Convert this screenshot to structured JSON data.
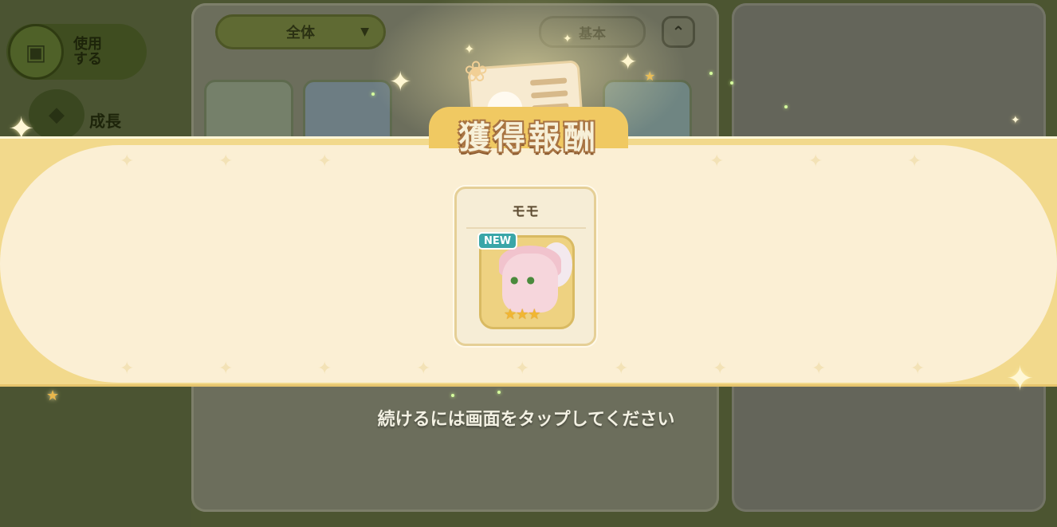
{
  "background": {
    "filter_dropdown": {
      "label": "全体",
      "caret": "▼"
    },
    "sort_button": {
      "label": "基本"
    },
    "collapse_button": {
      "label": "⌃"
    },
    "side_menu": {
      "use_label": "使用\nする",
      "grow_label": "成長"
    }
  },
  "reward_popup": {
    "title": "獲得報酬",
    "item": {
      "name": "モモ",
      "badge": "NEW",
      "stars": "★★★",
      "rarity": 3
    }
  },
  "hint": "続けるには画面をタップしてください",
  "colors": {
    "banner_gold": "#f2d98c",
    "banner_cream": "#fbefd4",
    "badge_teal": "#3aa6a8",
    "star_gold": "#f1b632",
    "title_brown": "#a87443"
  },
  "icons": {
    "use_icon": "box-icon",
    "grow_icon": "growth-icon",
    "collapse_icon": "double-chevron-up-icon",
    "dropdown_icon": "caret-down-icon"
  }
}
